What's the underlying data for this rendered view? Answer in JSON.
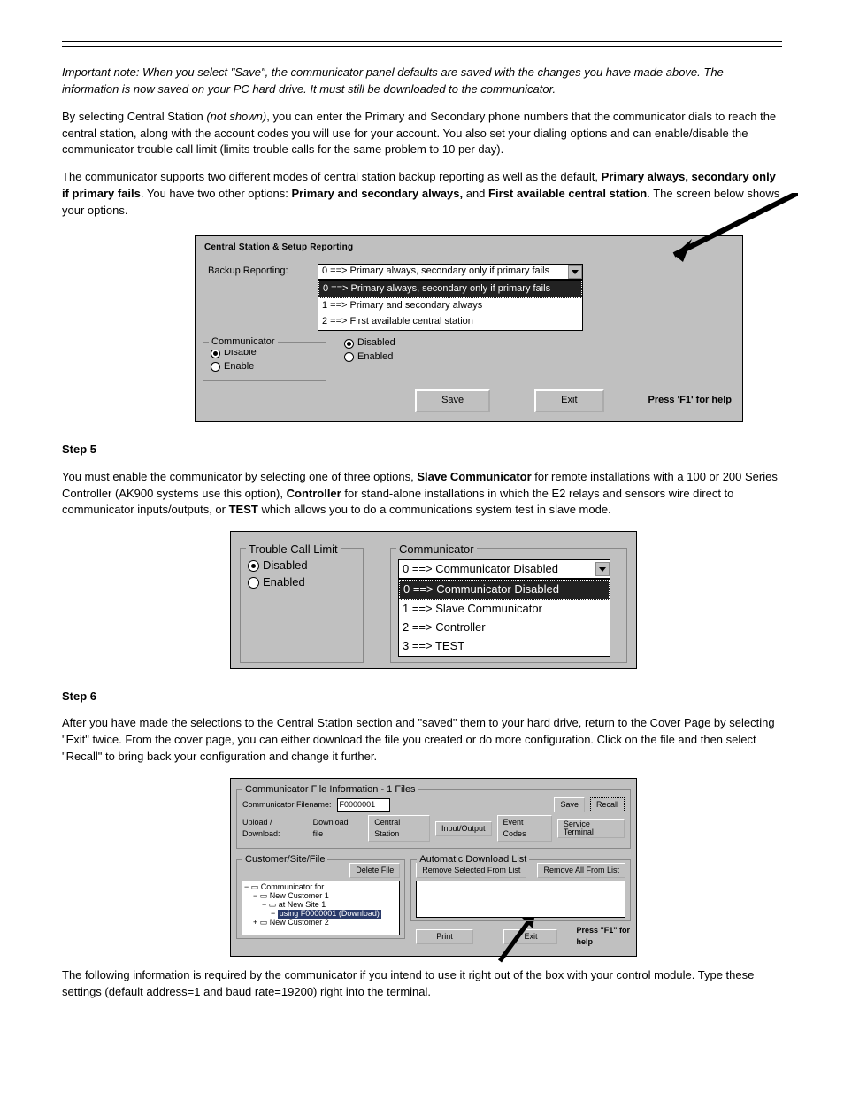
{
  "text": {
    "p1": "Important note: When you select \"Save\", the communicator panel defaults are saved with the changes you have made above. The information is now saved on your PC hard drive. It must still be downloaded to the communicator.",
    "p2a": "By selecting Central Station ",
    "p2b": "(not shown)",
    "p2c": ", you can enter the Primary and Secondary phone numbers that the communicator dials to reach the central station, along with the account codes you will use for your account. You also set your dialing options and can enable/disable the communicator trouble call limit (limits trouble calls for the same problem to 10 per day).",
    "p3a": "The communicator supports two different modes of central station backup reporting as well as the default, ",
    "p3b": "Primary always, secondary only if primary fails",
    "p3c": ". You have two other options: ",
    "p3d": "Primary and secondary always,",
    "p3e": " and ",
    "p3f": "First available central station",
    "p3g": ". The screen below shows your options.",
    "step5_label": "Step 5",
    "p4a": "You must enable the communicator by selecting one of three options, ",
    "p4b": "Slave Communicator",
    "p4c": " for remote installations with a 100 or 200 Series Controller (AK900 systems use this option), ",
    "p4d": "Controller",
    "p4e": " for stand-alone installations in which the E2 relays and sensors wire direct to communicator inputs/outputs, or ",
    "p4f": "TEST",
    "p4g": " which allows you to do a communications system test in slave mode.",
    "step6_label": "Step 6",
    "p5": "After you have made the selections to the Central Station section and \"saved\" them to your hard drive, return to the Cover Page by selecting \"Exit\" twice. From the cover page, you can either download the file you created or do more configuration. Click on the file and then select \"Recall\" to bring back your configuration and change it further.",
    "p6": "The following information is required by the communicator if you intend to use it right out of the box with your control module. Type these settings (default address=1 and baud rate=19200) right into the terminal."
  },
  "fig1": {
    "title_strip": "Central Station & Setup Reporting",
    "backup_label": "Backup Reporting:",
    "combo_value": "0 ==> Primary always, secondary only if primary fails",
    "dd": [
      "0 ==> Primary always, secondary only if primary fails",
      "1 ==> Primary and secondary always",
      "2 ==> First available central station"
    ],
    "grp_comm": "Communicator",
    "disable": "Disable",
    "enable": "Enable",
    "disabled": "Disabled",
    "enabled": "Enabled",
    "save": "Save",
    "exit": "Exit",
    "help": "Press 'F1' for help"
  },
  "fig2": {
    "grp_trouble": "Trouble Call Limit",
    "disabled": "Disabled",
    "enabled": "Enabled",
    "grp_comm": "Communicator",
    "combo_value": "0 ==> Communicator Disabled",
    "dd": [
      "0 ==> Communicator Disabled",
      "1 ==> Slave Communicator",
      "2 ==> Controller",
      "3 ==> TEST"
    ]
  },
  "fig3": {
    "box_title": "Communicator File Information - 1 Files",
    "fname_label": "Communicator Filename:",
    "fname_value": "F0000001",
    "updown_label": "Upload / Download:",
    "updown_value": "Download file",
    "save": "Save",
    "recall": "Recall",
    "tabs": [
      "Central Station",
      "Input/Output",
      "Event Codes",
      "Service Terminal"
    ],
    "cust_box": "Customer/Site/File",
    "delete_file": "Delete File",
    "auto_list": "Automatic Download List",
    "remove_sel": "Remove Selected From List",
    "remove_all": "Remove All From List",
    "tree": {
      "root": "Communicator for",
      "c1": "New Customer 1",
      "s1": "at New Site 1",
      "f1": "using F0000001 (Download)",
      "c2": "New Customer 2"
    },
    "print": "Print",
    "exit": "Exit",
    "help": "Press \"F1\" for help"
  }
}
